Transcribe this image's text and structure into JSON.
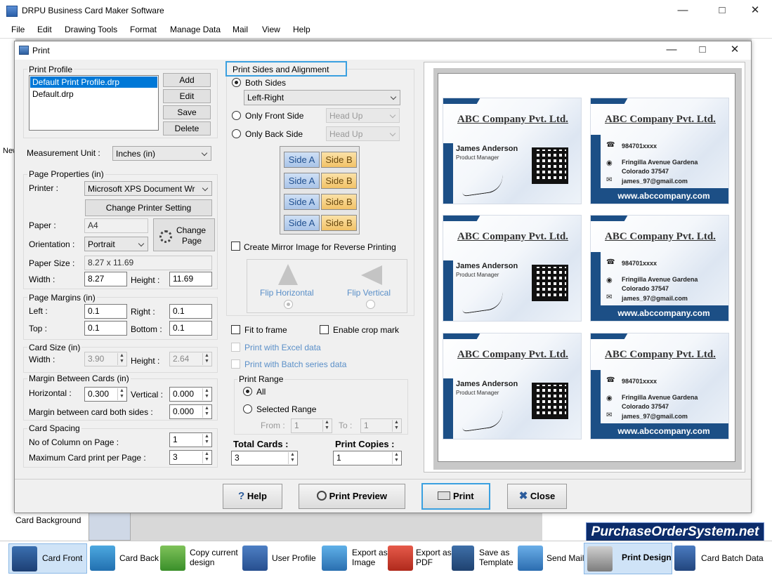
{
  "app": {
    "title": "DRPU Business Card Maker Software"
  },
  "menu": [
    "File",
    "Edit",
    "Drawing Tools",
    "Format",
    "Manage Data",
    "Mail",
    "View",
    "Help"
  ],
  "background": {
    "new_label": "New",
    "card_background_label": "Card Background"
  },
  "dialog": {
    "title": "Print",
    "print_profile": {
      "label": "Print Profile",
      "items": [
        "Default Print Profile.drp",
        "Default.drp"
      ],
      "buttons": {
        "add": "Add",
        "edit": "Edit",
        "save": "Save",
        "delete": "Delete"
      }
    },
    "measurement": {
      "label": "Measurement Unit :",
      "value": "Inches (in)"
    },
    "page_properties": {
      "label": "Page Properties (in)",
      "printer_label": "Printer :",
      "printer_value": "Microsoft XPS Document Wr",
      "change_printer": "Change Printer Setting",
      "paper_label": "Paper :",
      "paper_value": "A4",
      "change_page_line1": "Change",
      "change_page_line2": "Page",
      "orientation_label": "Orientation :",
      "orientation_value": "Portrait",
      "paper_size_label": "Paper Size :",
      "paper_size_value": "8.27 x 11.69",
      "width_label": "Width :",
      "width_value": "8.27",
      "height_label": "Height :",
      "height_value": "11.69"
    },
    "page_margins": {
      "label": "Page Margins (in)",
      "left_label": "Left :",
      "left_value": "0.1",
      "right_label": "Right :",
      "right_value": "0.1",
      "top_label": "Top :",
      "top_value": "0.1",
      "bottom_label": "Bottom :",
      "bottom_value": "0.1"
    },
    "card_size": {
      "label": "Card Size (in)",
      "width_label": "Width :",
      "width_value": "3.90",
      "height_label": "Height :",
      "height_value": "2.64"
    },
    "margin_between": {
      "label": "Margin Between Cards (in)",
      "horizontal_label": "Horizontal :",
      "horizontal_value": "0.300",
      "vertical_label": "Vertical :",
      "vertical_value": "0.000",
      "both_label": "Margin between card both sides :",
      "both_value": "0.000"
    },
    "card_spacing": {
      "label": "Card Spacing",
      "columns_label": "No of Column on Page :",
      "columns_value": "1",
      "max_label": "Maximum Card print per Page :",
      "max_value": "3"
    },
    "sides": {
      "label": "Print Sides and Alignment",
      "both_sides": "Both Sides",
      "alignment_value": "Left-Right",
      "front_only": "Only Front Side",
      "back_only": "Only Back Side",
      "head_up_1": "Head Up",
      "head_up_2": "Head Up",
      "side_a": "Side A",
      "side_b": "Side B",
      "mirror": "Create Mirror Image for Reverse Printing",
      "flip_h": "Flip Horizontal",
      "flip_v": "Flip Vertical"
    },
    "options": {
      "fit_to_frame": "Fit to frame",
      "crop_mark": "Enable crop mark",
      "excel": "Print with Excel data",
      "batch": "Print with Batch series data"
    },
    "print_range": {
      "label": "Print Range",
      "all": "All",
      "selected": "Selected Range",
      "from_label": "From :",
      "from_value": "1",
      "to_label": "To :",
      "to_value": "1"
    },
    "totals": {
      "total_label": "Total Cards :",
      "total_value": "3",
      "copies_label": "Print Copies :",
      "copies_value": "1"
    },
    "buttons": {
      "help": "Help",
      "preview": "Print Preview",
      "print": "Print",
      "close": "Close"
    }
  },
  "card": {
    "company": "ABC Company Pvt. Ltd.",
    "name": "James Anderson",
    "role": "Product Manager",
    "phone": "984701xxxx",
    "address1": "Fringilla Avenue Gardena",
    "address2": "Colorado 37547",
    "email": "james_97@gmail.com",
    "website": "www.abccompany.com"
  },
  "watermark": "PurchaseOrderSystem.net",
  "taskbar": {
    "card_front": "Card Front",
    "card_back": "Card Back",
    "copy_design_1": "Copy current",
    "copy_design_2": "design",
    "user_profile": "User Profile",
    "export_image_1": "Export as",
    "export_image_2": "Image",
    "export_pdf_1": "Export as",
    "export_pdf_2": "PDF",
    "save_template_1": "Save as",
    "save_template_2": "Template",
    "send_mail": "Send Mail",
    "print_design": "Print Design",
    "card_batch": "Card Batch Data"
  }
}
